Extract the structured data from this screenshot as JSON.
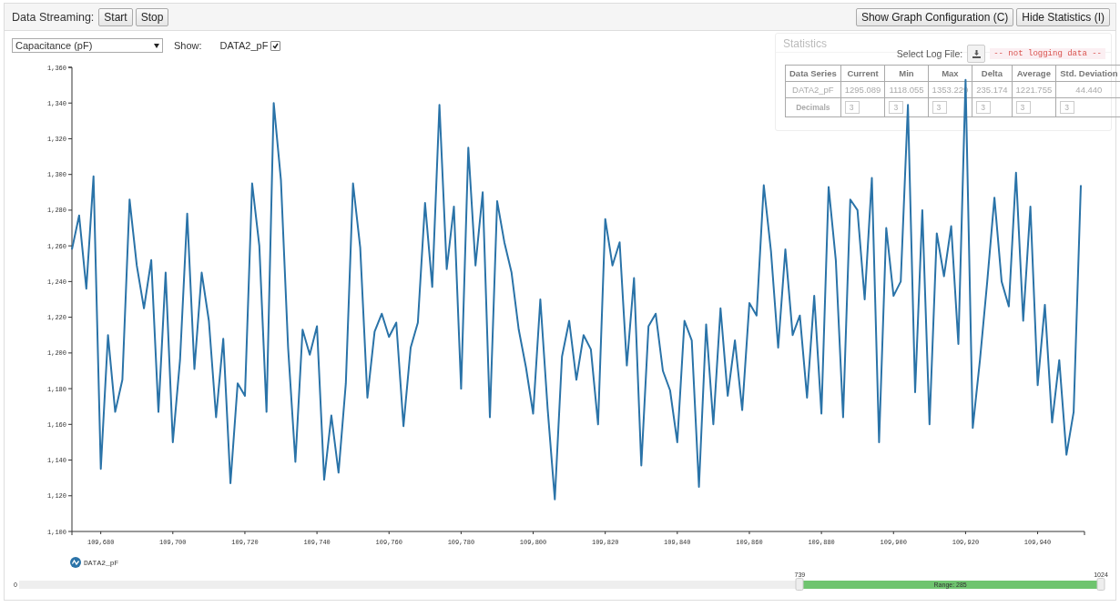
{
  "toolbar": {
    "label": "Data Streaming:",
    "left_buttons": [
      "Start",
      "Stop"
    ],
    "right_buttons": [
      "Show Graph Configuration (C)",
      "Hide Statistics (I)"
    ]
  },
  "controls": {
    "measurement": "Capacitance (pF)",
    "show_label": "Show:",
    "series": [
      {
        "label": "DATA2_pF",
        "checked": true
      }
    ]
  },
  "chart": {
    "chart_data": {
      "type": "line",
      "xlim": [
        109672,
        109953
      ],
      "ylim": [
        1100,
        1360
      ],
      "x": [
        109672,
        109674,
        109676,
        109678,
        109680,
        109682,
        109684,
        109686,
        109688,
        109690,
        109692,
        109694,
        109696,
        109698,
        109700,
        109702,
        109704,
        109706,
        109708,
        109710,
        109712,
        109714,
        109716,
        109718,
        109720,
        109722,
        109724,
        109726,
        109728,
        109730,
        109732,
        109734,
        109736,
        109738,
        109740,
        109742,
        109744,
        109746,
        109748,
        109750,
        109752,
        109754,
        109756,
        109758,
        109760,
        109762,
        109764,
        109766,
        109768,
        109770,
        109772,
        109774,
        109776,
        109778,
        109780,
        109782,
        109784,
        109786,
        109788,
        109790,
        109792,
        109794,
        109796,
        109798,
        109800,
        109802,
        109804,
        109806,
        109808,
        109810,
        109812,
        109814,
        109816,
        109818,
        109820,
        109822,
        109824,
        109826,
        109828,
        109830,
        109832,
        109834,
        109836,
        109838,
        109840,
        109842,
        109844,
        109846,
        109848,
        109850,
        109852,
        109854,
        109856,
        109858,
        109860,
        109862,
        109864,
        109866,
        109868,
        109870,
        109872,
        109874,
        109876,
        109878,
        109880,
        109882,
        109884,
        109886,
        109888,
        109890,
        109892,
        109894,
        109896,
        109898,
        109900,
        109902,
        109904,
        109906,
        109908,
        109910,
        109912,
        109914,
        109916,
        109918,
        109920,
        109922,
        109924,
        109926,
        109928,
        109930,
        109932,
        109934,
        109936,
        109938,
        109940,
        109942,
        109944,
        109946,
        109948,
        109950,
        109952
      ],
      "series": [
        {
          "name": "DATA2_pF",
          "color": "#2a73a8",
          "values": [
            1258,
            1277,
            1236,
            1299,
            1135,
            1210,
            1167,
            1185,
            1286,
            1249,
            1225,
            1252,
            1167,
            1245,
            1150,
            1196,
            1278,
            1191,
            1245,
            1218,
            1164,
            1208,
            1127,
            1183,
            1176,
            1295,
            1260,
            1167,
            1340,
            1297,
            1203,
            1139,
            1213,
            1199,
            1215,
            1129,
            1165,
            1133,
            1183,
            1295,
            1259,
            1175,
            1212,
            1222,
            1209,
            1217,
            1159,
            1203,
            1217,
            1284,
            1237,
            1339,
            1247,
            1282,
            1180,
            1315,
            1249,
            1290,
            1164,
            1285,
            1262,
            1245,
            1213,
            1192,
            1166,
            1230,
            1169,
            1118,
            1198,
            1218,
            1185,
            1210,
            1202,
            1160,
            1275,
            1249,
            1262,
            1193,
            1242,
            1137,
            1215,
            1222,
            1190,
            1179,
            1150,
            1218,
            1207,
            1125,
            1216,
            1160,
            1225,
            1176,
            1207,
            1168,
            1228,
            1221,
            1294,
            1257,
            1203,
            1258,
            1210,
            1221,
            1175,
            1232,
            1166,
            1293,
            1252,
            1164,
            1286,
            1280,
            1230,
            1298,
            1150,
            1270,
            1232,
            1240,
            1339,
            1178,
            1280,
            1160,
            1267,
            1243,
            1271,
            1205,
            1353,
            1158,
            1196,
            1240,
            1287,
            1240,
            1226,
            1301,
            1218,
            1282,
            1182,
            1227,
            1161,
            1196,
            1143,
            1167,
            1294
          ]
        }
      ],
      "xticks": [
        {
          "value": 109680,
          "label": "109,680"
        },
        {
          "value": 109700,
          "label": "109,700"
        },
        {
          "value": 109720,
          "label": "109,720"
        },
        {
          "value": 109740,
          "label": "109,740"
        },
        {
          "value": 109760,
          "label": "109,760"
        },
        {
          "value": 109780,
          "label": "109,780"
        },
        {
          "value": 109800,
          "label": "109,800"
        },
        {
          "value": 109820,
          "label": "109,820"
        },
        {
          "value": 109840,
          "label": "109,840"
        },
        {
          "value": 109860,
          "label": "109,860"
        },
        {
          "value": 109880,
          "label": "109,880"
        },
        {
          "value": 109900,
          "label": "109,900"
        },
        {
          "value": 109920,
          "label": "109,920"
        },
        {
          "value": 109940,
          "label": "109,940"
        }
      ],
      "yticks": [
        {
          "value": 1100,
          "label": "1,100"
        },
        {
          "value": 1120,
          "label": "1,120"
        },
        {
          "value": 1140,
          "label": "1,140"
        },
        {
          "value": 1160,
          "label": "1,160"
        },
        {
          "value": 1180,
          "label": "1,180"
        },
        {
          "value": 1200,
          "label": "1,200"
        },
        {
          "value": 1220,
          "label": "1,220"
        },
        {
          "value": 1240,
          "label": "1,240"
        },
        {
          "value": 1260,
          "label": "1,260"
        },
        {
          "value": 1280,
          "label": "1,280"
        },
        {
          "value": 1300,
          "label": "1,300"
        },
        {
          "value": 1320,
          "label": "1,320"
        },
        {
          "value": 1340,
          "label": "1,340"
        },
        {
          "value": 1360,
          "label": "1,360"
        }
      ]
    }
  },
  "statistics": {
    "title": "Statistics",
    "log_label": "Select Log File:",
    "log_status": "-- not logging data --",
    "columns": [
      "Data Series",
      "Current",
      "Min",
      "Max",
      "Delta",
      "Average",
      "Std. Deviation"
    ],
    "rows": [
      {
        "cells": [
          "DATA2_pF",
          "1295.089",
          "1118.055",
          "1353.229",
          "235.174",
          "1221.755",
          "44.440"
        ]
      }
    ],
    "decimals": {
      "label": "Decimals",
      "values": [
        "3",
        "3",
        "3",
        "3",
        "3",
        "3"
      ]
    }
  },
  "range": {
    "min": "0",
    "low": "739",
    "high": "1024",
    "label": "Range: 285"
  }
}
